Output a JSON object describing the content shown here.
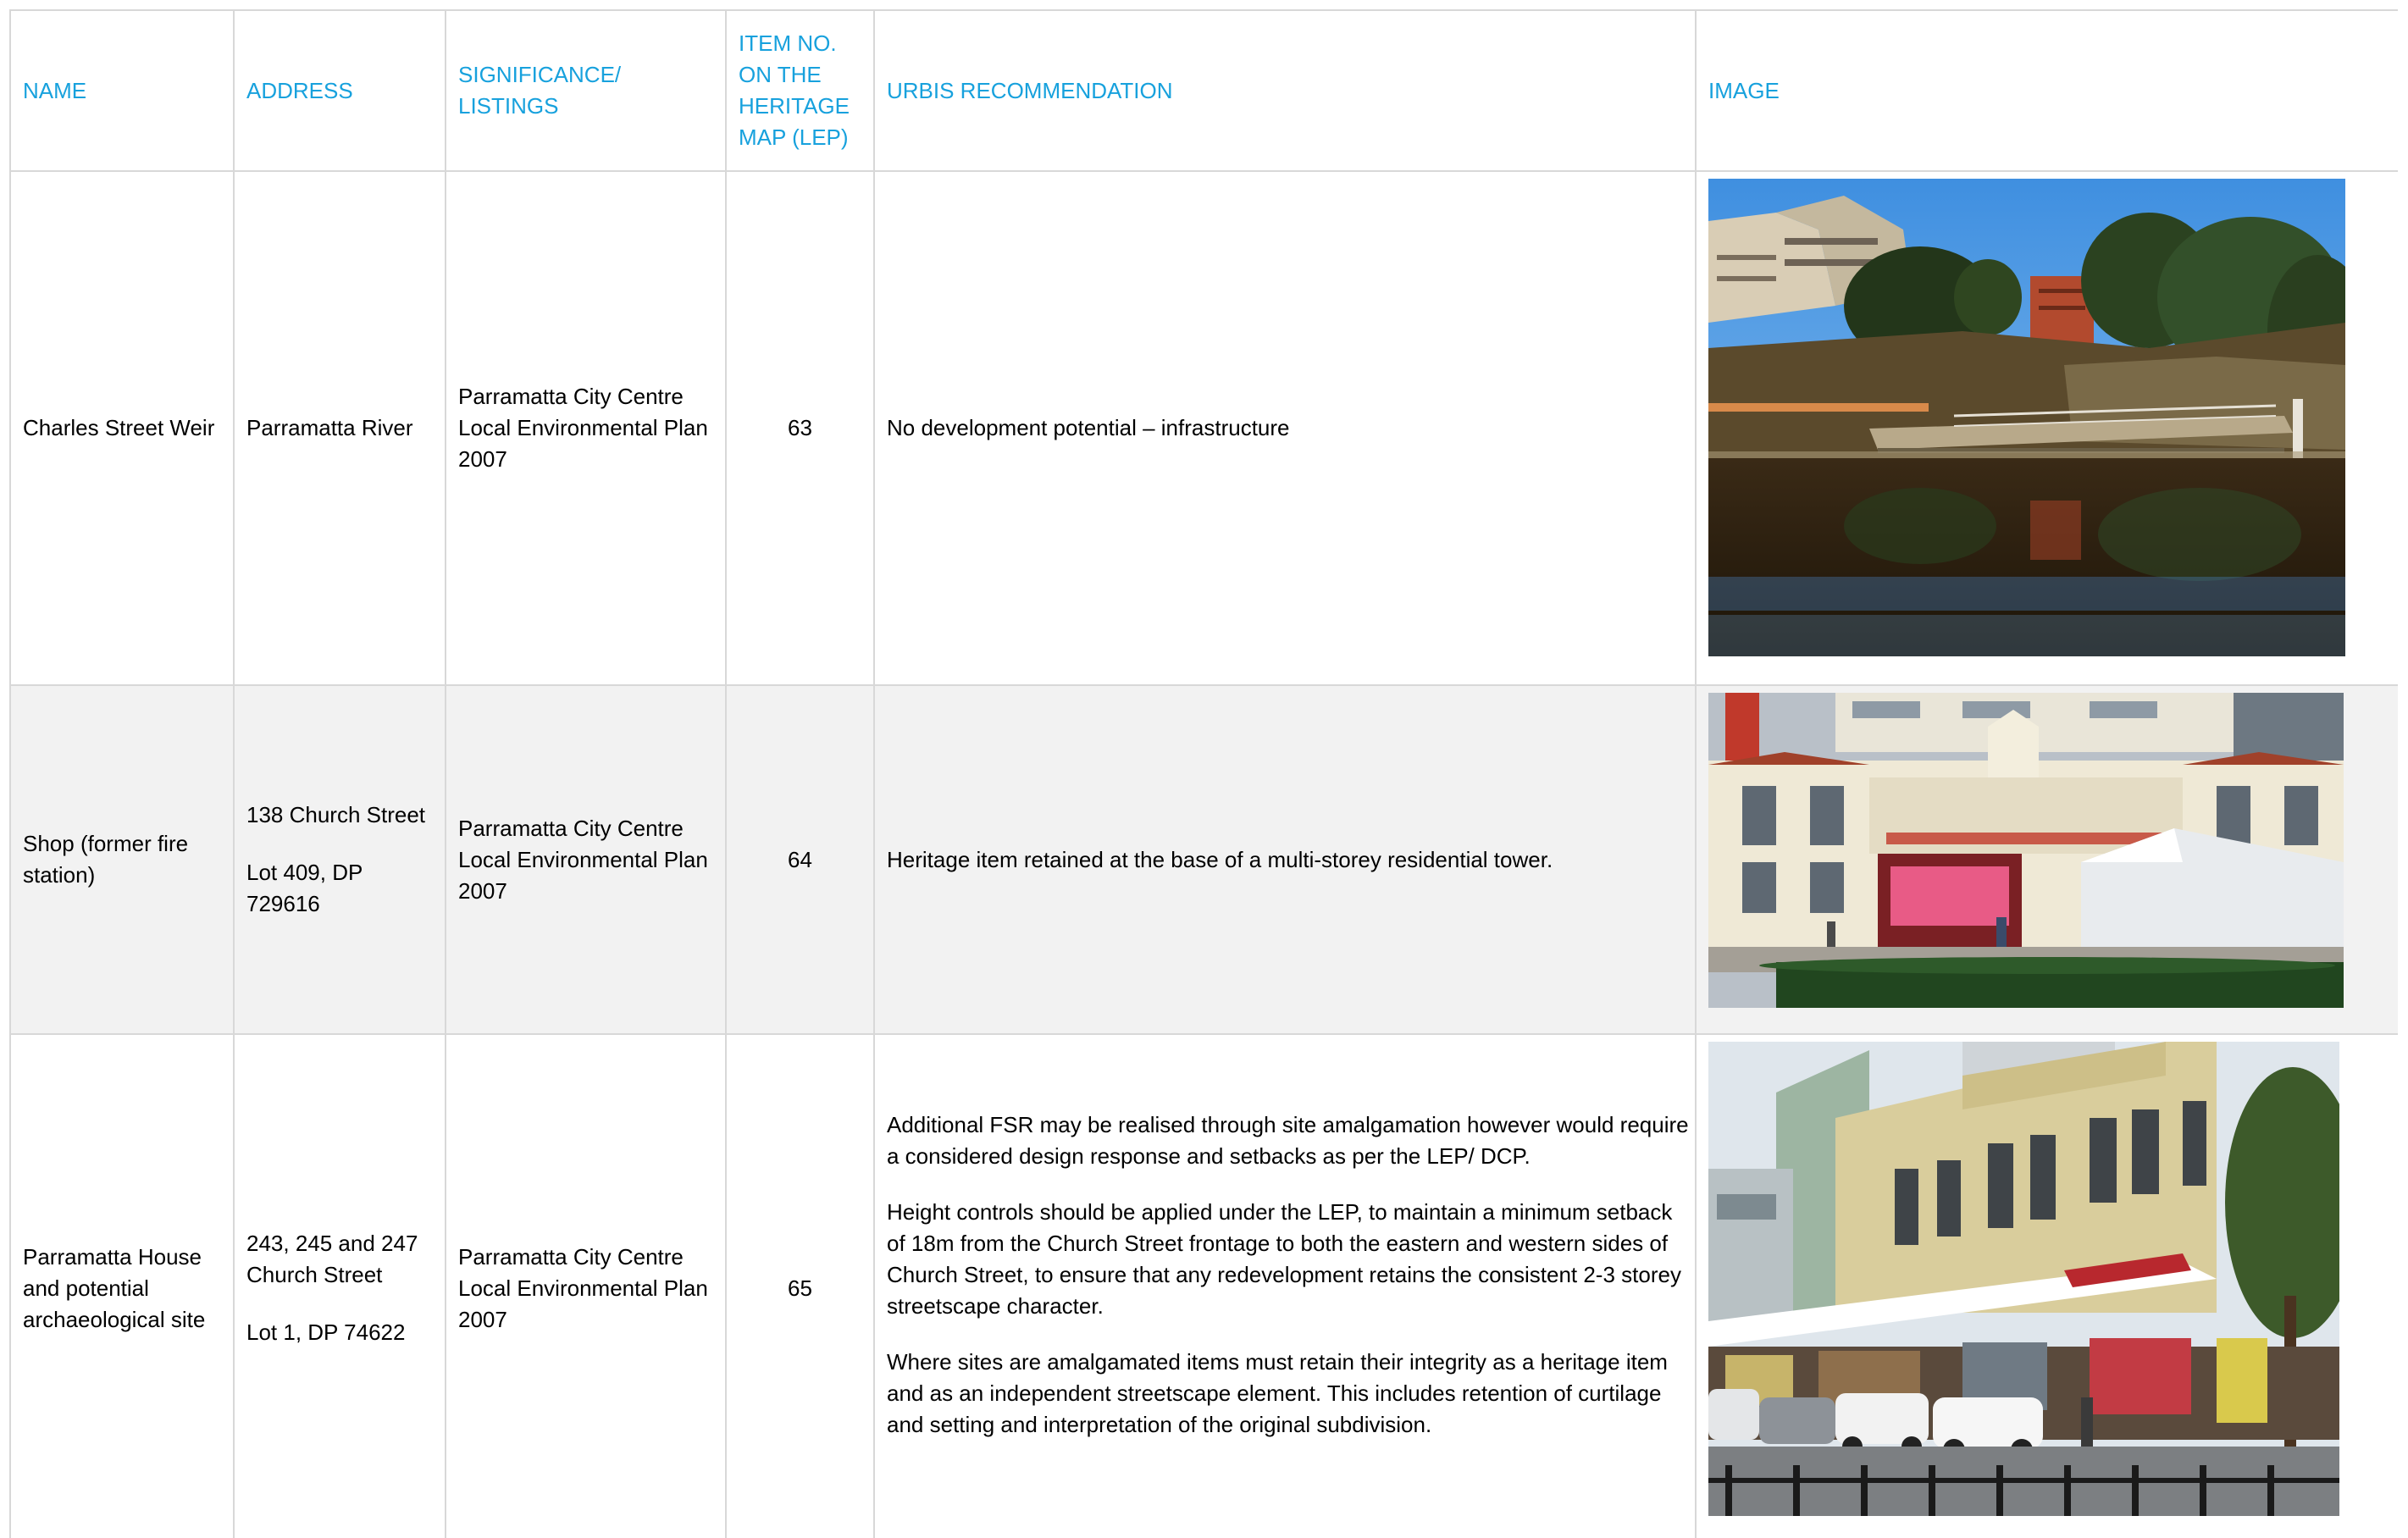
{
  "headers": {
    "name": "NAME",
    "address": "ADDRESS",
    "significance": "SIGNIFICANCE/ LISTINGS",
    "item_no": "ITEM NO. ON THE HERITAGE MAP (LEP)",
    "recommendation": "URBIS RECOMMENDATION",
    "image": "IMAGE"
  },
  "colors": {
    "header_text": "#17a1dd",
    "grid_lines": "#d8d8d8",
    "shaded_row": "#f2f2f2"
  },
  "rows": [
    {
      "name": "Charles Street Weir",
      "address_line1": "Parramatta River",
      "address_line2": "",
      "significance": "Parramatta City Centre Local Environmental Plan 2007",
      "item_no": "63",
      "recommendation": [
        "No development potential – infrastructure"
      ],
      "image_subject": "weir-river-photo"
    },
    {
      "name": "Shop (former fire station)",
      "address_line1": "138 Church Street",
      "address_line2": "Lot 409, DP 729616",
      "significance": "Parramatta City Centre Local Environmental Plan 2007",
      "item_no": "64",
      "recommendation": [
        "Heritage item retained at the base of a multi-storey residential tower."
      ],
      "image_subject": "former-fire-station-photo"
    },
    {
      "name": "Parramatta House and potential archaeological site",
      "address_line1": "243, 245 and 247 Church Street",
      "address_line2": "Lot 1, DP 74622",
      "significance": "Parramatta City Centre Local Environmental Plan 2007",
      "item_no": "65",
      "recommendation": [
        "Additional FSR may be realised through site amalgamation however would require a considered design response and setbacks as per the LEP/ DCP.",
        "Height controls should be applied under the LEP, to maintain a minimum setback of 18m from the Church Street frontage to both the eastern and western sides of Church Street, to ensure that any redevelopment retains the consistent 2-3 storey streetscape character.",
        "Where sites are amalgamated items must retain their integrity as a heritage item and as an independent streetscape element. This includes retention of curtilage and setting and interpretation of the original subdivision."
      ],
      "image_subject": "church-street-shopfronts-photo"
    }
  ]
}
